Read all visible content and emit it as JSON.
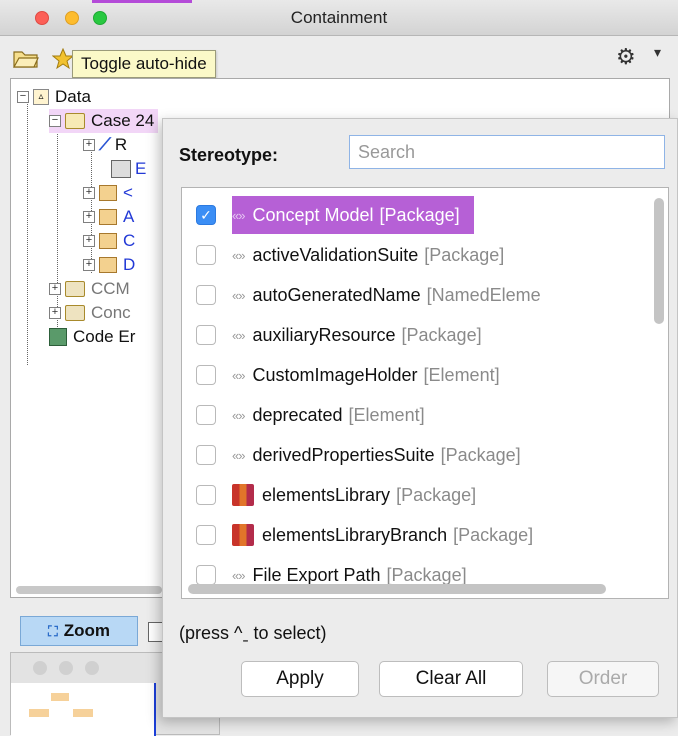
{
  "window": {
    "title": "Containment"
  },
  "tooltip": {
    "text": "Toggle auto-hide"
  },
  "tree": {
    "root": "Data",
    "case_node": "Case 24",
    "children_partial": [
      "R",
      "E",
      "<",
      "A",
      "C",
      "D"
    ],
    "ccm_partial": "CCM",
    "conc_partial": "Conc",
    "code_partial": "Code Er"
  },
  "zoom": {
    "label": "Zoom"
  },
  "popup": {
    "stereotype_label": "Stereotype:",
    "search_placeholder": "Search",
    "items": [
      {
        "name": "Concept Model",
        "type": "[Package]",
        "checked": true,
        "selected": true,
        "icon": "stereotype-icon"
      },
      {
        "name": "activeValidationSuite",
        "type": "[Package]",
        "checked": false,
        "icon": "stereotype-icon"
      },
      {
        "name": "autoGeneratedName",
        "type": "[NamedEleme",
        "checked": false,
        "icon": "stereotype-icon"
      },
      {
        "name": "auxiliaryResource",
        "type": "[Package]",
        "checked": false,
        "icon": "stereotype-icon"
      },
      {
        "name": "CustomImageHolder",
        "type": "[Element]",
        "checked": false,
        "icon": "stereotype-icon"
      },
      {
        "name": "deprecated",
        "type": "[Element]",
        "checked": false,
        "icon": "stereotype-icon"
      },
      {
        "name": "derivedPropertiesSuite",
        "type": "[Package]",
        "checked": false,
        "icon": "stereotype-icon"
      },
      {
        "name": "elementsLibrary",
        "type": "[Package]",
        "checked": false,
        "icon": "library-icon"
      },
      {
        "name": "elementsLibraryBranch",
        "type": "[Package]",
        "checked": false,
        "icon": "library-icon"
      },
      {
        "name": "File Export Path",
        "type": "[Package]",
        "checked": false,
        "icon": "stereotype-icon"
      }
    ],
    "hint": "(press ^ˍ to select)",
    "buttons": {
      "apply": "Apply",
      "clear_all": "Clear All",
      "order": "Order"
    }
  },
  "colors": {
    "selection": "#b660d6",
    "checkbox_on": "#3b8ef5",
    "link": "#2239d6"
  }
}
